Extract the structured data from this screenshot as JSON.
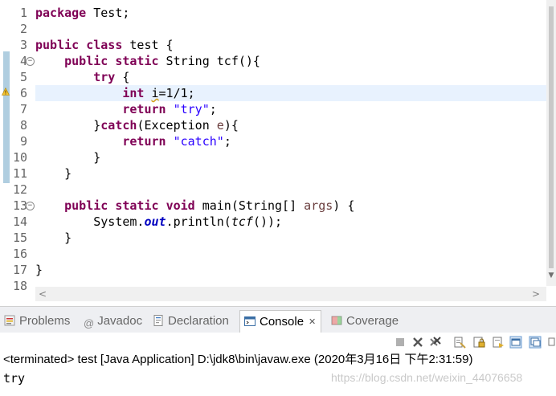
{
  "editor": {
    "line_numbers": [
      "1",
      "2",
      "3",
      "4",
      "5",
      "6",
      "7",
      "8",
      "9",
      "10",
      "11",
      "12",
      "13",
      "14",
      "15",
      "16",
      "17",
      "18"
    ],
    "code": {
      "l1": {
        "kw": "package",
        "rest": " Test;"
      },
      "l3": {
        "kw1": "public",
        "sp": " ",
        "kw2": "class",
        "rest": " test {"
      },
      "l4": {
        "indent": "    ",
        "kw1": "public",
        "kw2": "static",
        "rest": " String tcf(){"
      },
      "l5": {
        "indent": "        ",
        "kw": "try",
        "rest": " {"
      },
      "l6": {
        "indent": "            ",
        "kw": "int",
        "sp": " ",
        "var": "i",
        "rest": "=1/1;"
      },
      "l7": {
        "indent": "            ",
        "kw": "return",
        "str": "\"try\"",
        "rest": ";"
      },
      "l8": {
        "indent": "        ",
        "pre": "}",
        "kw": "catch",
        "mid": "(Exception ",
        "param": "e",
        "rest": "){"
      },
      "l9": {
        "indent": "            ",
        "kw": "return",
        "str": "\"catch\"",
        "rest": ";"
      },
      "l10": {
        "text": "        }"
      },
      "l11": {
        "text": "    }"
      },
      "l13": {
        "indent": "    ",
        "kw1": "public",
        "kw2": "static",
        "kw3": "void",
        "mid": " main(String[] ",
        "param": "args",
        "rest": ") {"
      },
      "l14": {
        "indent": "        ",
        "pre": "System.",
        "field": "out",
        "mid": ".println(",
        "method": "tcf",
        "rest": "());"
      },
      "l15": {
        "text": "    }"
      },
      "l17": {
        "text": "}"
      }
    }
  },
  "panel": {
    "tabs": [
      {
        "label": "Problems",
        "icon": "problems-icon"
      },
      {
        "label": "Javadoc",
        "icon": "javadoc-icon"
      },
      {
        "label": "Declaration",
        "icon": "declaration-icon"
      },
      {
        "label": "Console",
        "icon": "console-icon",
        "active": true
      },
      {
        "label": "Coverage",
        "icon": "coverage-icon"
      }
    ],
    "console": {
      "header": "<terminated> test [Java Application] D:\\jdk8\\bin\\javaw.exe (2020年3月16日 下午2:31:59)",
      "output": "try"
    },
    "watermark": "https://blog.csdn.net/weixin_44076658"
  },
  "colors": {
    "keyword": "#7f0055",
    "string": "#2a00ff",
    "field": "#0000c0",
    "current_line": "#e8f2fe"
  }
}
